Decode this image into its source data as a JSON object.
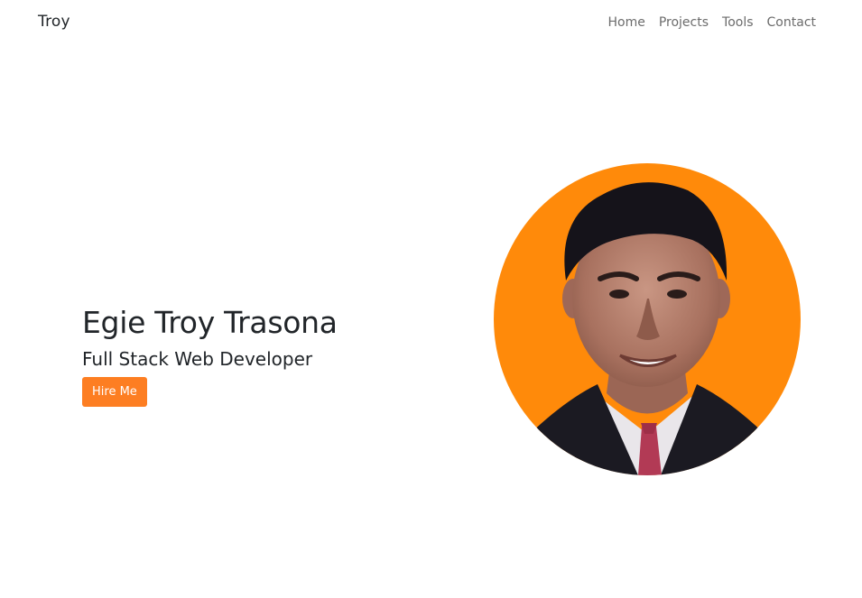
{
  "nav": {
    "brand": "Troy",
    "links": [
      "Home",
      "Projects",
      "Tools",
      "Contact"
    ]
  },
  "hero": {
    "name": "Egie Troy Trasona",
    "role": "Full Stack Web Developer",
    "cta_label": "Hire Me"
  },
  "colors": {
    "accent": "#fd7e22",
    "portrait_background": "#ff8a0a"
  },
  "icons": {
    "profile_photo": "profile-photo"
  }
}
